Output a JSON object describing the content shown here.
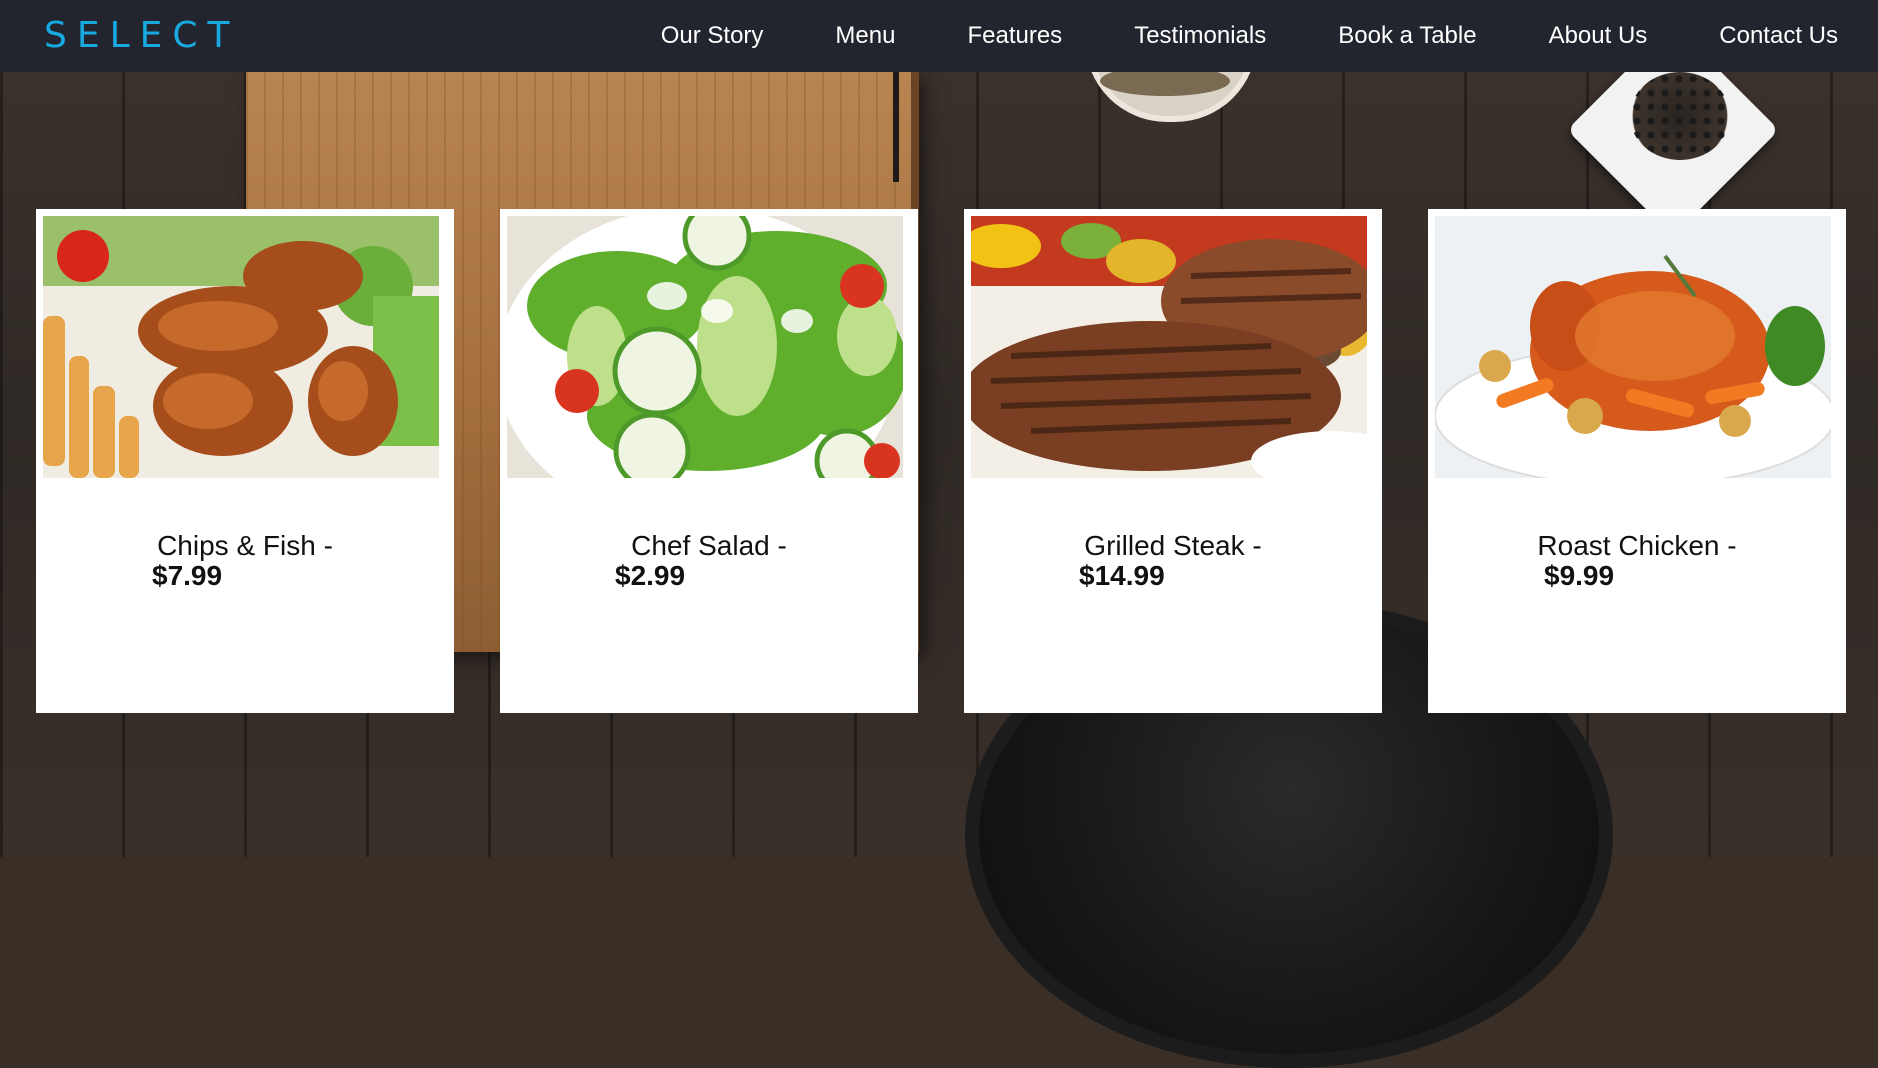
{
  "brand": {
    "logo_text": "SELECT",
    "accent_color": "#17a9e0"
  },
  "nav": {
    "items": [
      {
        "label": "Our Story"
      },
      {
        "label": "Menu"
      },
      {
        "label": "Features"
      },
      {
        "label": "Testimonials"
      },
      {
        "label": "Book a Table"
      },
      {
        "label": "About Us"
      },
      {
        "label": "Contact Us"
      }
    ]
  },
  "menu_cards": [
    {
      "name": "Chips & Fish -",
      "price": "$7.99",
      "image": "chicken-and-fries-photo"
    },
    {
      "name": "Chef Salad -",
      "price": "$2.99",
      "image": "salad-photo"
    },
    {
      "name": "Grilled Steak -",
      "price": "$14.99",
      "image": "grilled-steak-photo"
    },
    {
      "name": "Roast Chicken -",
      "price": "$9.99",
      "image": "roast-chicken-photo"
    }
  ]
}
